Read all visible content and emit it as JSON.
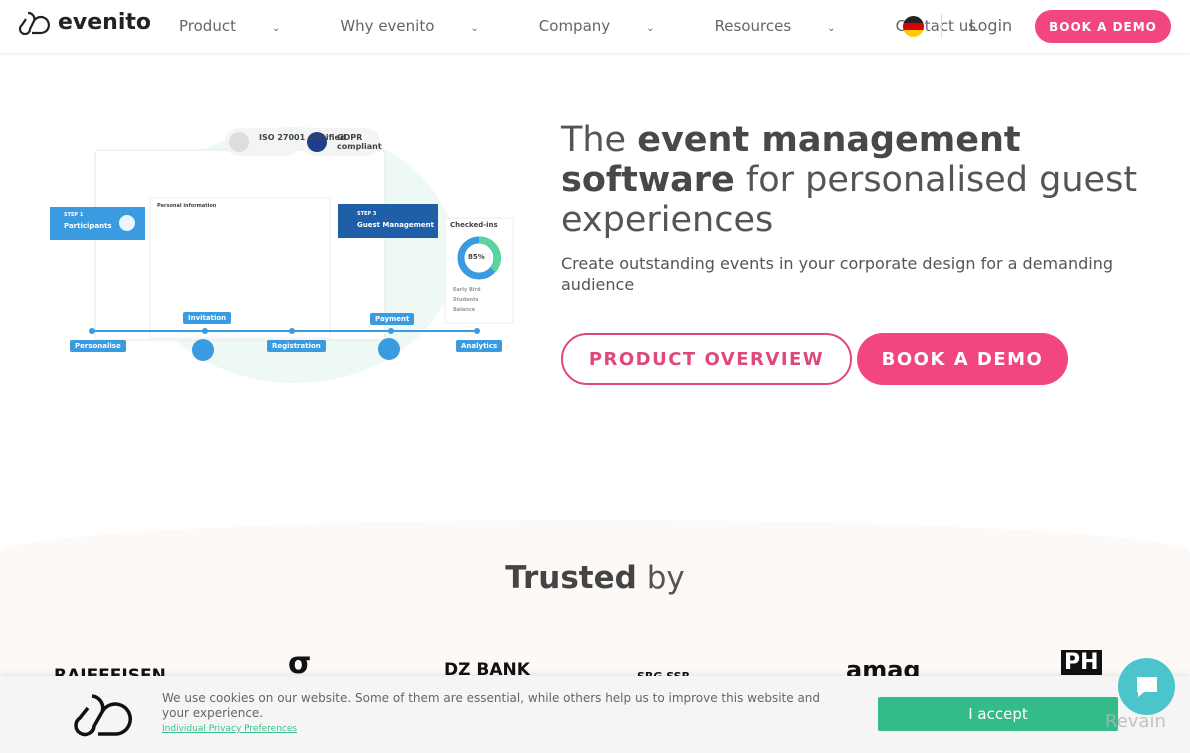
{
  "nav": {
    "brand": "evenito",
    "items": [
      {
        "label": "Product",
        "dropdown": true
      },
      {
        "label": "Why evenito",
        "dropdown": true
      },
      {
        "label": "Company",
        "dropdown": true
      },
      {
        "label": "Resources",
        "dropdown": true
      },
      {
        "label": "Contact us",
        "dropdown": false
      }
    ],
    "language": "German flag",
    "login": "Login",
    "demo": "BOOK A DEMO"
  },
  "hero": {
    "title_pre": "The ",
    "title_bold1": "event management software",
    "title_post": " for personalised guest experiences",
    "subtitle": "Create outstanding events in your corporate design for a demanding audience",
    "btn_overview": "PRODUCT OVERVIEW",
    "btn_demo": "BOOK A DEMO"
  },
  "illustration": {
    "iso": "ISO 27001 certified",
    "gdpr": "GDPR compliant",
    "step1_label": "STEP 1",
    "step1": "Participants",
    "step3_label": "STEP 3",
    "step3": "Guest Management",
    "checkins": "Checked-ins",
    "percent": "85%",
    "legend": [
      "Early Bird",
      "Students",
      "Balance"
    ],
    "timeline": [
      "Personalise",
      "Invitation",
      "Registration",
      "Payment",
      "Analytics"
    ],
    "form_title": "Personal information"
  },
  "trusted": {
    "bold": "Trusted",
    "rest": " by",
    "logos": [
      "RAIFFEISEN",
      "σ",
      "DZ BANK",
      "SRG SSR",
      "amag",
      "PH"
    ]
  },
  "cookie": {
    "text": "We use cookies on our website. Some of them are essential, while others help us to improve this website and your experience.",
    "link": "Individual Privacy Preferences",
    "accept": "I accept"
  },
  "watermark": "Revain",
  "colors": {
    "accent": "#f2467e",
    "blue": "#3a9be0",
    "green": "#33bb8a",
    "chat": "#4cc4cc"
  }
}
